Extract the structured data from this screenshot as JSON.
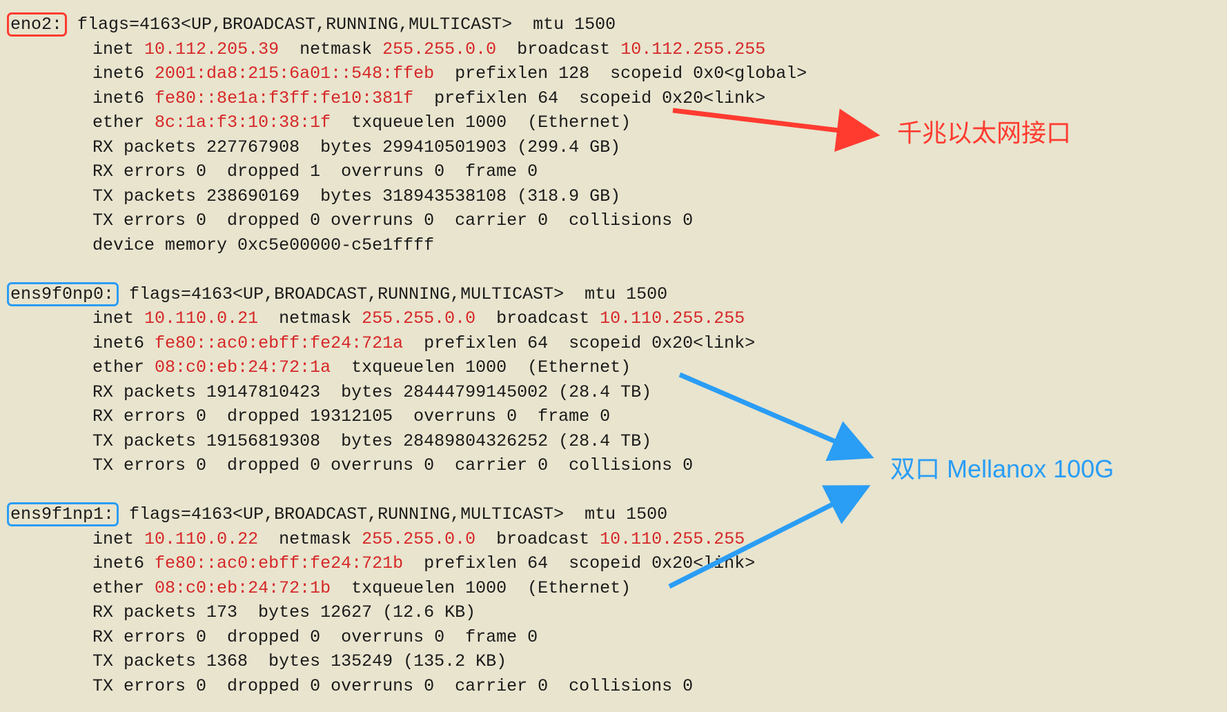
{
  "annotations": {
    "red_label": "千兆以太网接口",
    "blue_label": "双口 Mellanox 100G"
  },
  "interfaces": [
    {
      "name": "eno2:",
      "box": "red",
      "flags_line": " flags=4163<UP,BROADCAST,RUNNING,MULTICAST>  mtu 1500",
      "lines": [
        {
          "segs": [
            {
              "t": "        inet "
            },
            {
              "t": "10.112.205.39",
              "c": "red"
            },
            {
              "t": "  netmask "
            },
            {
              "t": "255.255.0.0",
              "c": "red"
            },
            {
              "t": "  broadcast "
            },
            {
              "t": "10.112.255.255",
              "c": "red"
            }
          ]
        },
        {
          "segs": [
            {
              "t": "        inet6 "
            },
            {
              "t": "2001:da8:215:6a01::548:ffeb",
              "c": "red"
            },
            {
              "t": "  prefixlen 128  scopeid 0x0<global>"
            }
          ]
        },
        {
          "segs": [
            {
              "t": "        inet6 "
            },
            {
              "t": "fe80::8e1a:f3ff:fe10:381f",
              "c": "red"
            },
            {
              "t": "  prefixlen 64  scopeid 0x20<link>"
            }
          ]
        },
        {
          "segs": [
            {
              "t": "        ether "
            },
            {
              "t": "8c:1a:f3:10:38:1f",
              "c": "red"
            },
            {
              "t": "  txqueuelen 1000  (Ethernet)"
            }
          ]
        },
        {
          "segs": [
            {
              "t": "        RX packets 227767908  bytes 299410501903 (299.4 GB)"
            }
          ]
        },
        {
          "segs": [
            {
              "t": "        RX errors 0  dropped 1  overruns 0  frame 0"
            }
          ]
        },
        {
          "segs": [
            {
              "t": "        TX packets 238690169  bytes 318943538108 (318.9 GB)"
            }
          ]
        },
        {
          "segs": [
            {
              "t": "        TX errors 0  dropped 0 overruns 0  carrier 0  collisions 0"
            }
          ]
        },
        {
          "segs": [
            {
              "t": "        device memory 0xc5e00000-c5e1ffff"
            }
          ]
        }
      ]
    },
    {
      "name": "ens9f0np0:",
      "box": "blue",
      "flags_line": " flags=4163<UP,BROADCAST,RUNNING,MULTICAST>  mtu 1500",
      "lines": [
        {
          "segs": [
            {
              "t": "        inet "
            },
            {
              "t": "10.110.0.21",
              "c": "red"
            },
            {
              "t": "  netmask "
            },
            {
              "t": "255.255.0.0",
              "c": "red"
            },
            {
              "t": "  broadcast "
            },
            {
              "t": "10.110.255.255",
              "c": "red"
            }
          ]
        },
        {
          "segs": [
            {
              "t": "        inet6 "
            },
            {
              "t": "fe80::ac0:ebff:fe24:721a",
              "c": "red"
            },
            {
              "t": "  prefixlen 64  scopeid 0x20<link>"
            }
          ]
        },
        {
          "segs": [
            {
              "t": "        ether "
            },
            {
              "t": "08:c0:eb:24:72:1a",
              "c": "red"
            },
            {
              "t": "  txqueuelen 1000  (Ethernet)"
            }
          ]
        },
        {
          "segs": [
            {
              "t": "        RX packets 19147810423  bytes 28444799145002 (28.4 TB)"
            }
          ]
        },
        {
          "segs": [
            {
              "t": "        RX errors 0  dropped 19312105  overruns 0  frame 0"
            }
          ]
        },
        {
          "segs": [
            {
              "t": "        TX packets 19156819308  bytes 28489804326252 (28.4 TB)"
            }
          ]
        },
        {
          "segs": [
            {
              "t": "        TX errors 0  dropped 0 overruns 0  carrier 0  collisions 0"
            }
          ]
        }
      ]
    },
    {
      "name": "ens9f1np1:",
      "box": "blue",
      "flags_line": " flags=4163<UP,BROADCAST,RUNNING,MULTICAST>  mtu 1500",
      "lines": [
        {
          "segs": [
            {
              "t": "        inet "
            },
            {
              "t": "10.110.0.22",
              "c": "red"
            },
            {
              "t": "  netmask "
            },
            {
              "t": "255.255.0.0",
              "c": "red"
            },
            {
              "t": "  broadcast "
            },
            {
              "t": "10.110.255.255",
              "c": "red"
            }
          ]
        },
        {
          "segs": [
            {
              "t": "        inet6 "
            },
            {
              "t": "fe80::ac0:ebff:fe24:721b",
              "c": "red"
            },
            {
              "t": "  prefixlen 64  scopeid 0x20<link>"
            }
          ]
        },
        {
          "segs": [
            {
              "t": "        ether "
            },
            {
              "t": "08:c0:eb:24:72:1b",
              "c": "red"
            },
            {
              "t": "  txqueuelen 1000  (Ethernet)"
            }
          ]
        },
        {
          "segs": [
            {
              "t": "        RX packets 173  bytes 12627 (12.6 KB)"
            }
          ]
        },
        {
          "segs": [
            {
              "t": "        RX errors 0  dropped 0  overruns 0  frame 0"
            }
          ]
        },
        {
          "segs": [
            {
              "t": "        TX packets 1368  bytes 135249 (135.2 KB)"
            }
          ]
        },
        {
          "segs": [
            {
              "t": "        TX errors 0  dropped 0 overruns 0  carrier 0  collisions 0"
            }
          ]
        }
      ]
    }
  ]
}
